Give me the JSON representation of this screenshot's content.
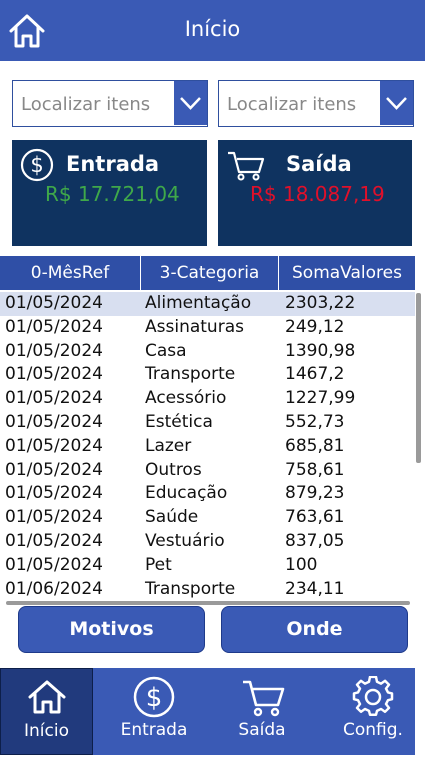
{
  "header": {
    "title": "Início",
    "icon": "home-icon"
  },
  "filters": [
    {
      "placeholder": "Localizar itens"
    },
    {
      "placeholder": "Localizar itens"
    }
  ],
  "cards": {
    "entrada": {
      "label": "Entrada",
      "value": "R$ 17.721,04",
      "color": "#3fa84a",
      "icon": "dollar-icon"
    },
    "saida": {
      "label": "Saída",
      "value": "R$ 18.087,19",
      "color": "#e0102a",
      "icon": "cart-icon"
    }
  },
  "table": {
    "columns": [
      "0-MêsRef",
      "3-Categoria",
      "SomaValores"
    ],
    "rows": [
      [
        "01/05/2024",
        "Alimentação",
        "2303,22"
      ],
      [
        "01/05/2024",
        "Assinaturas",
        "249,12"
      ],
      [
        "01/05/2024",
        "Casa",
        "1390,98"
      ],
      [
        "01/05/2024",
        "Transporte",
        "1467,2"
      ],
      [
        "01/05/2024",
        "Acessório",
        "1227,99"
      ],
      [
        "01/05/2024",
        "Estética",
        "552,73"
      ],
      [
        "01/05/2024",
        "Lazer",
        "685,81"
      ],
      [
        "01/05/2024",
        "Outros",
        "758,61"
      ],
      [
        "01/05/2024",
        "Educação",
        "879,23"
      ],
      [
        "01/05/2024",
        "Saúde",
        "763,61"
      ],
      [
        "01/05/2024",
        "Vestuário",
        "837,05"
      ],
      [
        "01/05/2024",
        "Pet",
        "100"
      ],
      [
        "01/06/2024",
        "Transporte",
        "234,11"
      ]
    ]
  },
  "buttons": {
    "motivos": "Motivos",
    "onde": "Onde"
  },
  "nav": [
    {
      "label": "Início",
      "icon": "home-icon"
    },
    {
      "label": "Entrada",
      "icon": "dollar-icon"
    },
    {
      "label": "Saída",
      "icon": "cart-icon"
    },
    {
      "label": "Config.",
      "icon": "gear-icon"
    }
  ],
  "colors": {
    "primary": "#3a5ab5",
    "card": "#0f3360",
    "nav_active": "#213a7d"
  }
}
